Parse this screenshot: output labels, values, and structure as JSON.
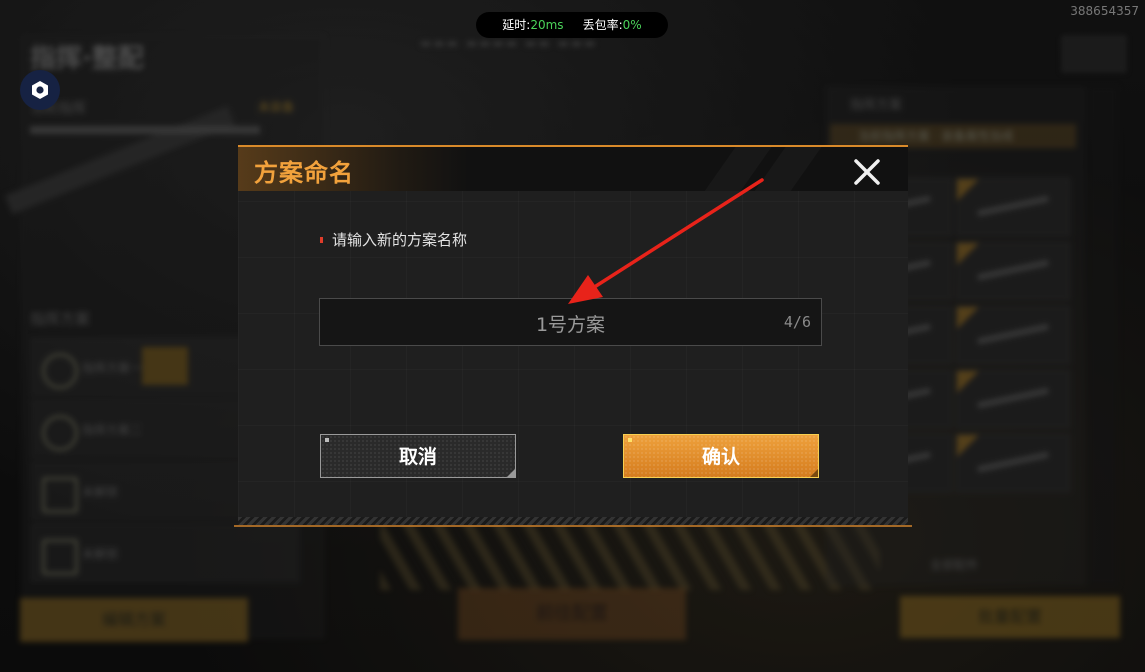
{
  "status": {
    "latency_label": "延时:",
    "latency_value": "20ms",
    "loss_label": "丢包率:",
    "loss_value": "0%"
  },
  "user_id": "388654357",
  "background": {
    "title": "指挥·整配",
    "subtitle": "当前指挥",
    "side_tag": "未装备",
    "section": "指挥方案",
    "rows": [
      "指挥方案一",
      "指挥方案二",
      "未解锁",
      "未解锁"
    ],
    "left_button": "编辑方案",
    "mid_button": "前往配置",
    "right_button": "批量配置",
    "right_header": "指挥方案",
    "right_highlight": "当前指挥方案 · 装备属性加成",
    "settings_label": "全部配件"
  },
  "modal": {
    "title": "方案命名",
    "prompt": "请输入新的方案名称",
    "input_value": "1号方案",
    "char_count": "4/6",
    "cancel_label": "取消",
    "confirm_label": "确认"
  },
  "colors": {
    "accent": "#f2a23c",
    "confirm": "#e28a28",
    "status_green": "#4bd35a",
    "annotation_arrow": "#e8231a"
  }
}
